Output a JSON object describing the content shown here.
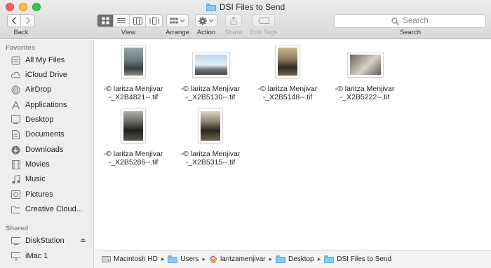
{
  "window": {
    "title": "DSI Files to Send"
  },
  "colors": {
    "close": "#fc605c",
    "minimize": "#fdbc40",
    "zoom": "#34c84a",
    "folder": "#8ccbf5"
  },
  "toolbar": {
    "back_label": "Back",
    "view_label": "View",
    "arrange_label": "Arrange",
    "action_label": "Action",
    "share_label": "Share",
    "edit_tags_label": "Edit Tags",
    "search_placeholder": "Search",
    "search_label": "Search"
  },
  "sidebar": {
    "favorites_header": "Favorites",
    "favorites": [
      {
        "label": "All My Files",
        "icon": "all-files-icon"
      },
      {
        "label": "iCloud Drive",
        "icon": "cloud-icon"
      },
      {
        "label": "AirDrop",
        "icon": "airdrop-icon"
      },
      {
        "label": "Applications",
        "icon": "applications-icon"
      },
      {
        "label": "Desktop",
        "icon": "desktop-icon"
      },
      {
        "label": "Documents",
        "icon": "documents-icon"
      },
      {
        "label": "Downloads",
        "icon": "downloads-icon"
      },
      {
        "label": "Movies",
        "icon": "movies-icon"
      },
      {
        "label": "Music",
        "icon": "music-icon"
      },
      {
        "label": "Pictures",
        "icon": "pictures-icon"
      },
      {
        "label": "Creative Cloud...",
        "icon": "folder-icon"
      }
    ],
    "shared_header": "Shared",
    "shared": [
      {
        "label": "DiskStation",
        "icon": "network-drive-icon"
      },
      {
        "label": "iMac 1",
        "icon": "imac-icon"
      }
    ]
  },
  "files": [
    {
      "line1": "-© laritza Menjivar",
      "line2": "-_X2B4821--.tif",
      "orientation": "portrait"
    },
    {
      "line1": "-© laritza Menjivar",
      "line2": "-_X2B5130--.tif",
      "orientation": "landscape"
    },
    {
      "line1": "-© laritza Menjivar",
      "line2": "-_X2B5148--.tif",
      "orientation": "portrait"
    },
    {
      "line1": "-© laritza Menjivar",
      "line2": "-_X2B5222--.tif",
      "orientation": "landscape"
    },
    {
      "line1": "-© laritza Menjivar",
      "line2": "-_X2B5286--.tif",
      "orientation": "portrait"
    },
    {
      "line1": "-© laritza Menjivar",
      "line2": "-_X2B5315--.tif",
      "orientation": "portrait"
    }
  ],
  "pathbar": {
    "items": [
      "Macintosh HD",
      "Users",
      "laritzamenjivar",
      "Desktop",
      "DSI Files to Send"
    ]
  }
}
